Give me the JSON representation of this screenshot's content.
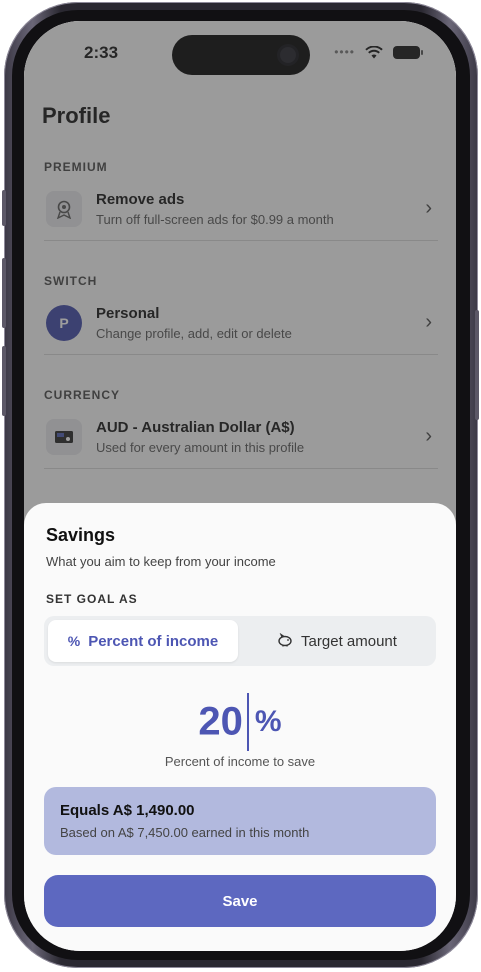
{
  "status_bar": {
    "time": "2:33"
  },
  "profile": {
    "title": "Profile",
    "sections": [
      {
        "label": "PREMIUM",
        "item": {
          "title": "Remove ads",
          "subtitle": "Turn off full-screen ads for $0.99 a month",
          "icon": "ribbon-icon"
        }
      },
      {
        "label": "SWITCH",
        "item": {
          "title": "Personal",
          "subtitle": "Change profile, add, edit or delete",
          "avatar_letter": "P"
        }
      },
      {
        "label": "CURRENCY",
        "item": {
          "title": "AUD - Australian Dollar (A$)",
          "subtitle": "Used for every amount in this profile",
          "icon": "banknote-icon"
        }
      }
    ]
  },
  "sheet": {
    "title": "Savings",
    "subtitle": "What you aim to keep from your income",
    "goal_label": "SET GOAL AS",
    "options": [
      {
        "label": "Percent of income",
        "icon": "percent-icon",
        "selected": true
      },
      {
        "label": "Target amount",
        "icon": "piggy-bank-icon",
        "selected": false
      }
    ],
    "value": "20",
    "value_symbol": "%",
    "value_caption": "Percent of income to save",
    "equals": {
      "title": "Equals A$ 1,490.00",
      "subtitle": "Based on A$ 7,450.00 earned in this month"
    },
    "save_label": "Save"
  },
  "colors": {
    "accent": "#4d56b3",
    "button": "#5d68c0",
    "card": "#b2b9de"
  }
}
